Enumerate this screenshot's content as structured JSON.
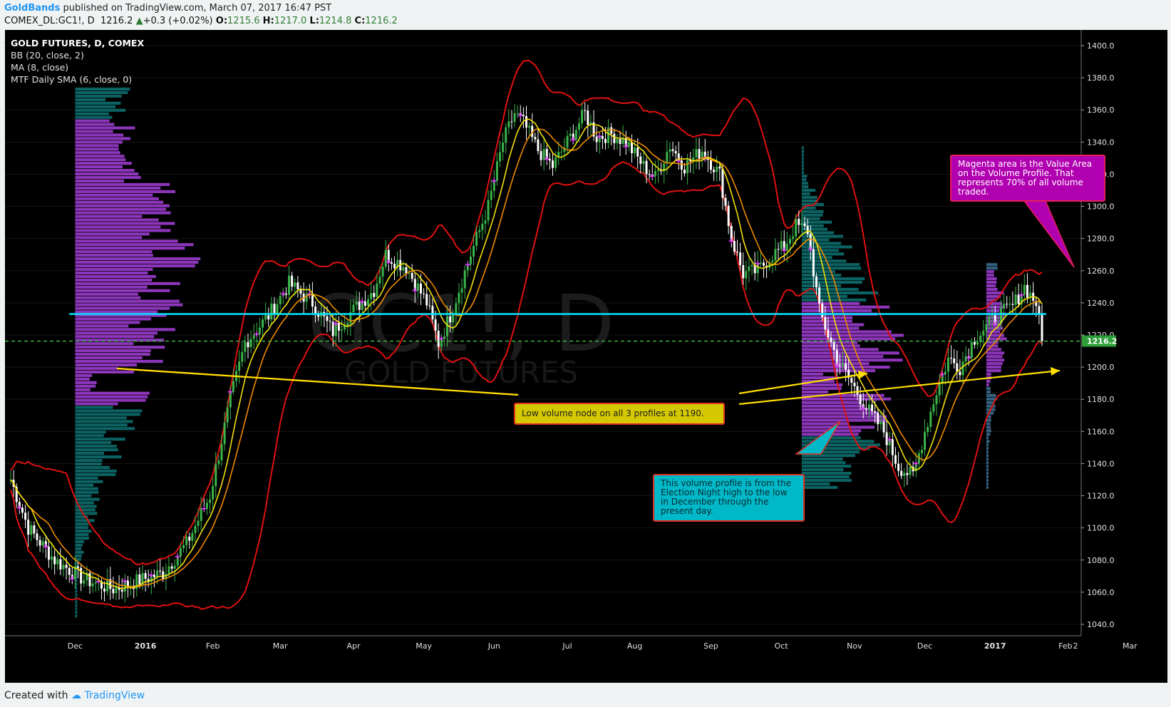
{
  "header": {
    "author": "GoldBands",
    "published_text": "published on TradingView.com, March 07, 2017 16:47 PST",
    "symbol": "COMEX_DL:GC1!, D",
    "price": "1216.2",
    "change": "+0.3 (+0.02%)",
    "o_label": "O:",
    "o_value": "1215.6",
    "h_label": "H:",
    "h_value": "1217.0",
    "l_label": "L:",
    "l_value": "1214.8",
    "c_label": "C:",
    "c_value": "1216.2"
  },
  "legend": {
    "title": "GOLD FUTURES, D, COMEX",
    "bb": "BB (20, close, 2)",
    "ma": "MA (8, close)",
    "mtf": "MTF Daily SMA (6, close, 0)"
  },
  "watermark": {
    "symbol": "GC1!, D",
    "name": "GOLD FUTURES"
  },
  "footer": {
    "created_with": "Created with",
    "brand": "TradingView"
  },
  "annotations": {
    "magenta": "Magenta area is the Value Area on the Volume Profile. That represents 70% of all volume traded.",
    "yellow": "Low volume node on all 3 profiles at 1190.",
    "cyan": "This volume profile is from the Election Night high to the low in December through the present day."
  },
  "colors": {
    "background": "#000000",
    "bollinger": "#e01010",
    "ma8": "#f5e10a",
    "sma_mtf": "#f08a00",
    "candle_up": "#3bb54a",
    "candle_down": "#ffffff",
    "marker": "#e040fb",
    "value_area": "#9c3ccf",
    "profile_outside": "#0c6e6e",
    "poc_line": "#00e5ff",
    "last_price_line": "#3bb54a"
  },
  "chart_data": {
    "type": "line",
    "title": "GOLD FUTURES, D, COMEX",
    "xlabel": "",
    "ylabel": "",
    "ylim": [
      1030,
      1410
    ],
    "yticks": [
      1040,
      1060,
      1080,
      1100,
      1120,
      1140,
      1160,
      1180,
      1200,
      1220,
      1240,
      1260,
      1280,
      1300,
      1320,
      1340,
      1360,
      1380,
      1400
    ],
    "x_tick_labels": [
      "Dec",
      "2016",
      "Feb",
      "Mar",
      "Apr",
      "May",
      "Jun",
      "Jul",
      "Aug",
      "Sep",
      "Oct",
      "Nov",
      "Dec",
      "2017",
      "Feb",
      "Mar",
      "2"
    ],
    "last_price_label": "1216.2",
    "last_price": 1216.2,
    "poc_level": 1233,
    "series": [
      {
        "name": "BB (20, close, 2)",
        "kind": "bollinger",
        "key": "bb"
      },
      {
        "name": "MA (8, close)",
        "kind": "ma",
        "key": "ma8"
      },
      {
        "name": "MTF Daily SMA (6, close, 0)",
        "kind": "sma",
        "key": "sma"
      }
    ],
    "price_path": [
      [
        0,
        1130
      ],
      [
        6,
        1100
      ],
      [
        15,
        1080
      ],
      [
        25,
        1068
      ],
      [
        35,
        1062
      ],
      [
        45,
        1068
      ],
      [
        52,
        1072
      ],
      [
        60,
        1090
      ],
      [
        68,
        1120
      ],
      [
        75,
        1180
      ],
      [
        80,
        1215
      ],
      [
        88,
        1232
      ],
      [
        95,
        1252
      ],
      [
        103,
        1240
      ],
      [
        110,
        1222
      ],
      [
        115,
        1232
      ],
      [
        124,
        1248
      ],
      [
        128,
        1270
      ],
      [
        135,
        1262
      ],
      [
        142,
        1240
      ],
      [
        146,
        1215
      ],
      [
        150,
        1232
      ],
      [
        157,
        1270
      ],
      [
        163,
        1300
      ],
      [
        168,
        1340
      ],
      [
        172,
        1358
      ],
      [
        175,
        1352
      ],
      [
        180,
        1335
      ],
      [
        185,
        1325
      ],
      [
        190,
        1340
      ],
      [
        196,
        1358
      ],
      [
        200,
        1343
      ],
      [
        205,
        1345
      ],
      [
        210,
        1340
      ],
      [
        216,
        1325
      ],
      [
        220,
        1318
      ],
      [
        225,
        1338
      ],
      [
        230,
        1325
      ],
      [
        236,
        1335
      ],
      [
        242,
        1320
      ],
      [
        246,
        1280
      ],
      [
        250,
        1258
      ],
      [
        255,
        1260
      ],
      [
        260,
        1270
      ],
      [
        264,
        1275
      ],
      [
        268,
        1288
      ],
      [
        272,
        1285
      ],
      [
        276,
        1235
      ],
      [
        282,
        1205
      ],
      [
        287,
        1190
      ],
      [
        292,
        1175
      ],
      [
        298,
        1160
      ],
      [
        303,
        1138
      ],
      [
        308,
        1132
      ],
      [
        312,
        1160
      ],
      [
        316,
        1185
      ],
      [
        320,
        1205
      ],
      [
        324,
        1200
      ],
      [
        329,
        1218
      ],
      [
        333,
        1225
      ],
      [
        337,
        1232
      ],
      [
        342,
        1238
      ],
      [
        346,
        1250
      ],
      [
        350,
        1240
      ],
      [
        352,
        1216
      ]
    ],
    "profiles": [
      {
        "name": "profile-1",
        "x_start": 22,
        "low": 1045,
        "high": 1375,
        "va_low": 1175,
        "va_high": 1355
      },
      {
        "name": "profile-2",
        "x_start": 270,
        "low": 1125,
        "high": 1337,
        "va_low": 1158,
        "va_high": 1240
      },
      {
        "name": "profile-3",
        "x_start": 333,
        "low": 1125,
        "high": 1265,
        "va_low": 1188,
        "va_high": 1260
      }
    ],
    "bars_total": 353
  }
}
